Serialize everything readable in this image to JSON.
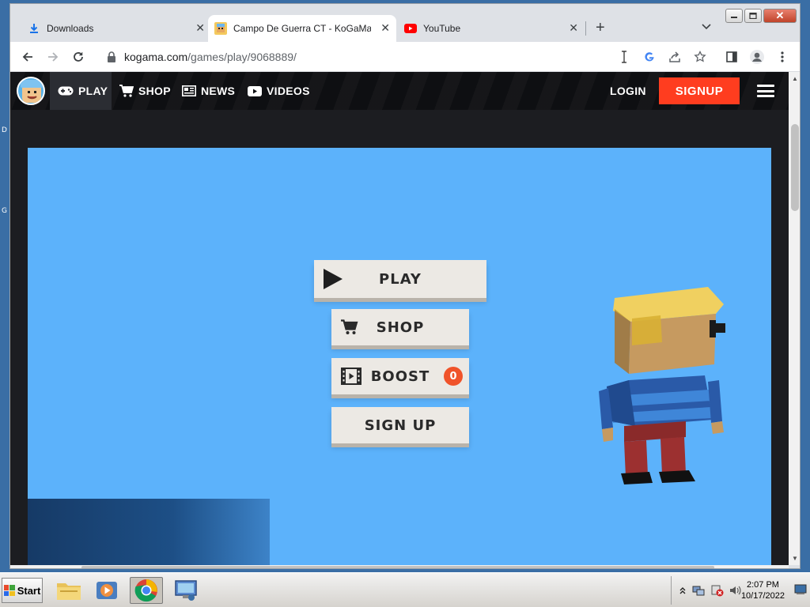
{
  "desktop": {
    "labels": [
      "D",
      "G"
    ]
  },
  "browser": {
    "tabs": [
      {
        "title": "Downloads",
        "icon": "download-icon"
      },
      {
        "title": "Campo De Guerra CT - KoGaMa - Pl",
        "icon": "kogama-favicon"
      },
      {
        "title": "YouTube",
        "icon": "youtube-icon"
      }
    ],
    "new_tab": "+",
    "tab_search": "⌄",
    "window_controls": {
      "minimize": "—",
      "maximize": "▢",
      "close": "✕"
    },
    "url_host": "kogama.com",
    "url_path": "/games/play/9068889/"
  },
  "site_nav": {
    "play": "PLAY",
    "shop": "SHOP",
    "news": "NEWS",
    "videos": "VIDEOS",
    "login": "LOGIN",
    "signup": "SIGNUP"
  },
  "game_menu": {
    "play": "PLAY",
    "shop": "SHOP",
    "boost": "BOOST",
    "boost_count": "0",
    "signup": "SIGN UP"
  },
  "taskbar": {
    "start": "Start",
    "time": "2:07 PM",
    "date": "10/17/2022"
  },
  "colors": {
    "game_bg": "#5cb2fb",
    "signup_bg": "#ff3d1f",
    "nav_bg": "#0e0f12",
    "badge": "#f0532a"
  }
}
